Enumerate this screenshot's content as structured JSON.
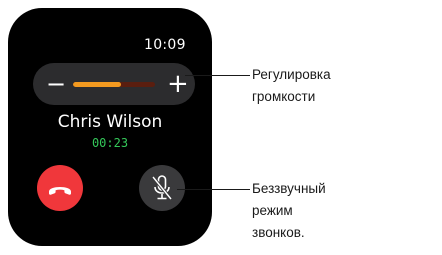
{
  "watch": {
    "time": "10:09",
    "volume": {
      "minus_label": "−",
      "plus_label": "+",
      "level": 0.58,
      "fill_color": "#f39a20",
      "track_color": "#5a1e0f"
    },
    "caller_name": "Chris Wilson",
    "call_duration": "00:23",
    "end_call_color": "#f0373b",
    "duration_color": "#34c759",
    "end_icon": "phone-hangup-icon",
    "mute_icon": "microphone-off-icon"
  },
  "callouts": {
    "volume_line1": "Регулировка",
    "volume_line2": "громкости",
    "mute_line1": "Беззвучный",
    "mute_line2": "режим",
    "mute_line3": "звонков."
  }
}
